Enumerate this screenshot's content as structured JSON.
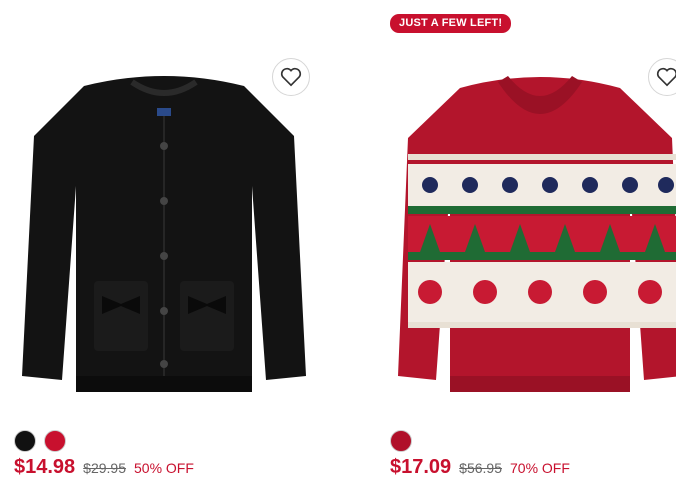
{
  "products": [
    {
      "badge": "",
      "image_icon": "black-cardigan-image",
      "swatches": [
        "#111111",
        "#c8102e"
      ],
      "price": "$14.98",
      "was_price": "$29.95",
      "discount": "50% OFF",
      "favorite_icon": "heart-icon"
    },
    {
      "badge": "JUST A FEW LEFT!",
      "image_icon": "red-fair-isle-sweater-image",
      "swatches": [
        "#b0102a"
      ],
      "price": "$17.09",
      "was_price": "$56.95",
      "discount": "70% OFF",
      "favorite_icon": "heart-icon"
    }
  ],
  "colors": {
    "accent": "#c8102e"
  }
}
